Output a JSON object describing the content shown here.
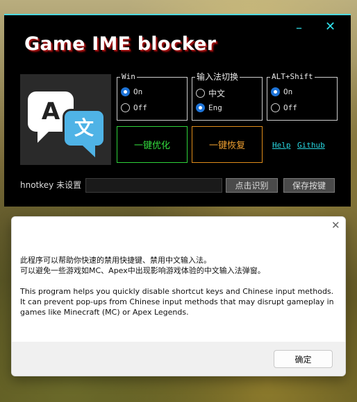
{
  "app": {
    "title": "Game IME blocker",
    "minimize_glyph": "–",
    "close_glyph": "✕",
    "logo": {
      "glyph_a": "A",
      "glyph_b": "文",
      "icon": "translate-icon"
    },
    "groups": {
      "win": {
        "label": "Win",
        "options": [
          {
            "label": "On",
            "checked": true
          },
          {
            "label": "Off",
            "checked": false
          }
        ]
      },
      "ime_switch": {
        "label": "输入法切换",
        "options": [
          {
            "label": "中文",
            "checked": false
          },
          {
            "label": "Eng",
            "checked": true
          }
        ]
      },
      "alt_shift": {
        "label": "ALT+Shift",
        "options": [
          {
            "label": "On",
            "checked": true
          },
          {
            "label": "Off",
            "checked": false
          }
        ]
      }
    },
    "optimize_button": "一键优化",
    "restore_button": "一键恢复",
    "help_link": "Help",
    "github_link": "Github",
    "hotkey_label": "hnotkey 未设置",
    "hotkey_value": "",
    "detect_button": "点击识别",
    "save_button": "保存按键",
    "accent_color": "#4dd9e0"
  },
  "dialog": {
    "close_glyph": "✕",
    "lines_cn": [
      "此程序可以帮助你快速的禁用快捷键、禁用中文输入法。",
      "可以避免一些游戏如MC、Apex中出现影响游戏体验的中文输入法弹窗。"
    ],
    "lines_en": [
      "This program helps you quickly disable shortcut keys and Chinese input methods.",
      "It can prevent pop-ups from Chinese input methods that may disrupt gameplay in",
      "games like Minecraft (MC) or Apex Legends."
    ],
    "ok_button": "确定"
  }
}
